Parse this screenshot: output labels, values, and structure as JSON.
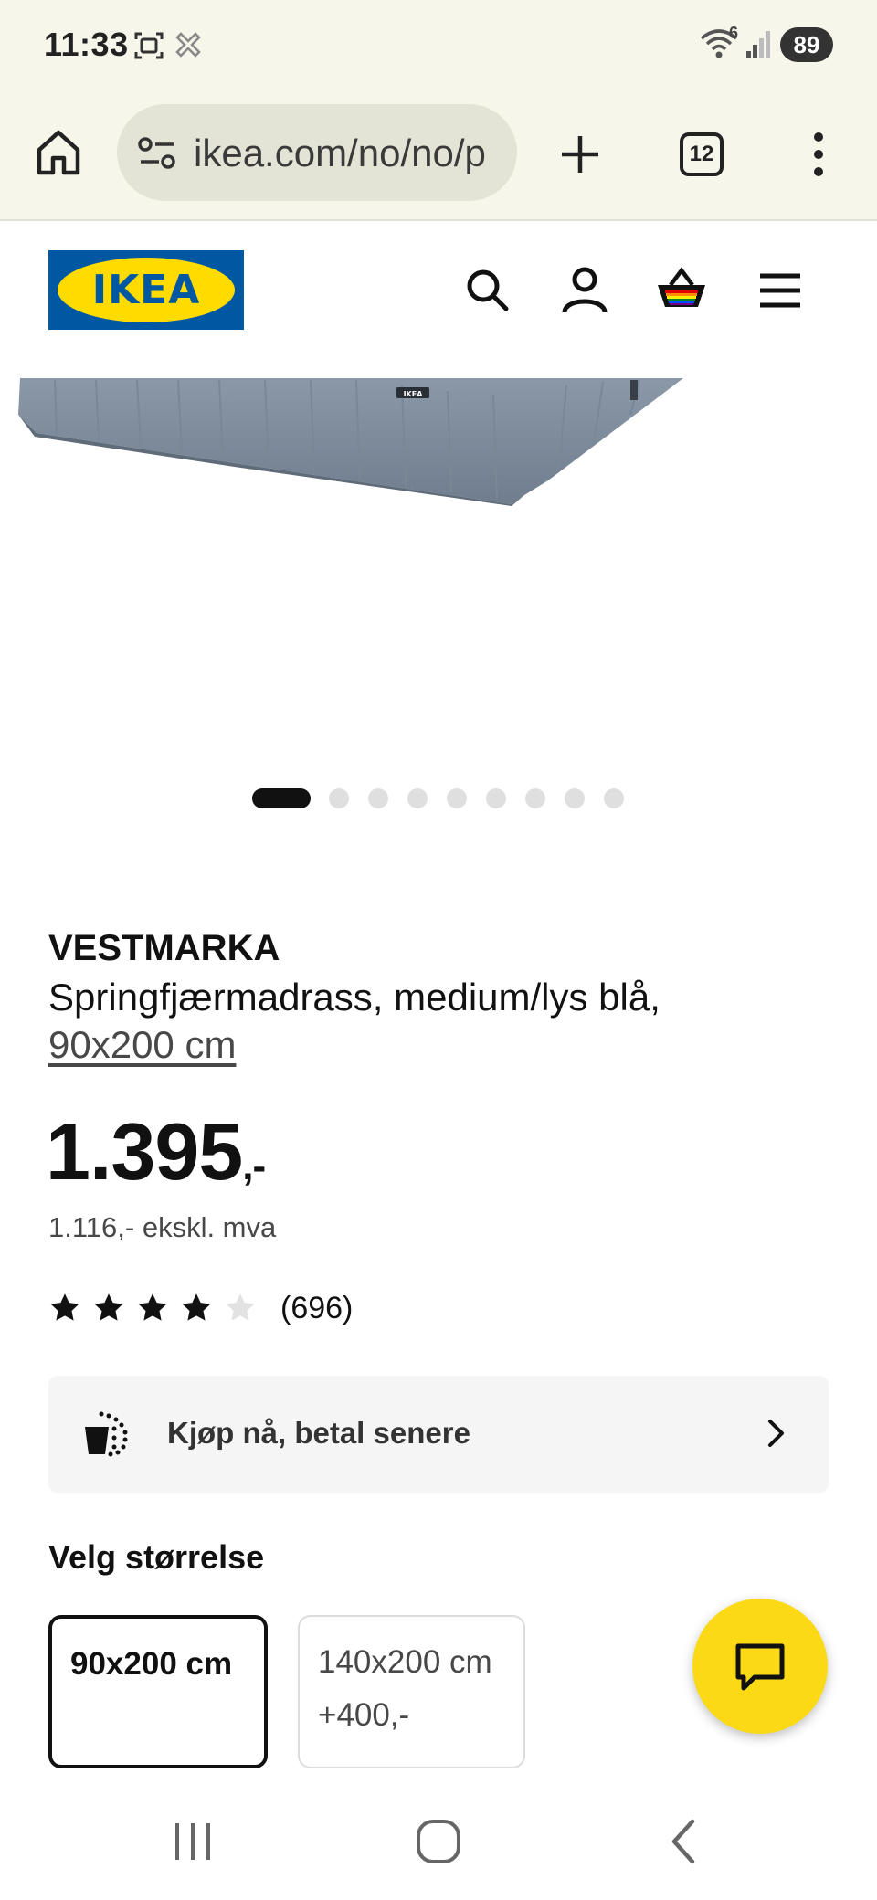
{
  "status_bar": {
    "time": "11:33",
    "battery": "89",
    "network_badge": "6"
  },
  "browser": {
    "url": "ikea.com/no/no/p",
    "tab_count": "12",
    "icons": [
      "home-icon",
      "site-settings-icon",
      "new-tab-icon",
      "tab-switcher-icon",
      "more-menu-icon"
    ]
  },
  "header": {
    "logo_text": "IKEA",
    "icons": [
      "search-icon",
      "account-icon",
      "cart-icon",
      "menu-icon"
    ]
  },
  "carousel": {
    "active_index": 0,
    "total": 10
  },
  "product": {
    "name": "VESTMARKA",
    "description": "Springfjærmadrass, medium/lys blå,",
    "size_link": "90x200 cm",
    "price": "1.395",
    "price_suffix": ",-",
    "price_excl_vat": "1.116,- ekskl. mva",
    "rating_value": 4,
    "rating_max": 5,
    "review_count": "(696)"
  },
  "bnpl": {
    "label": "Kjøp nå, betal senere"
  },
  "size_selector": {
    "title": "Velg størrelse",
    "options": [
      {
        "label": "90x200 cm",
        "extra": "",
        "selected": true
      },
      {
        "label": "140x200 cm",
        "extra": "+400,-",
        "selected": false
      }
    ]
  },
  "colors": {
    "ikea_blue": "#0058a3",
    "ikea_yellow": "#ffdb00",
    "chat_yellow": "#fbd914",
    "browser_chrome": "#f6f6ea"
  }
}
